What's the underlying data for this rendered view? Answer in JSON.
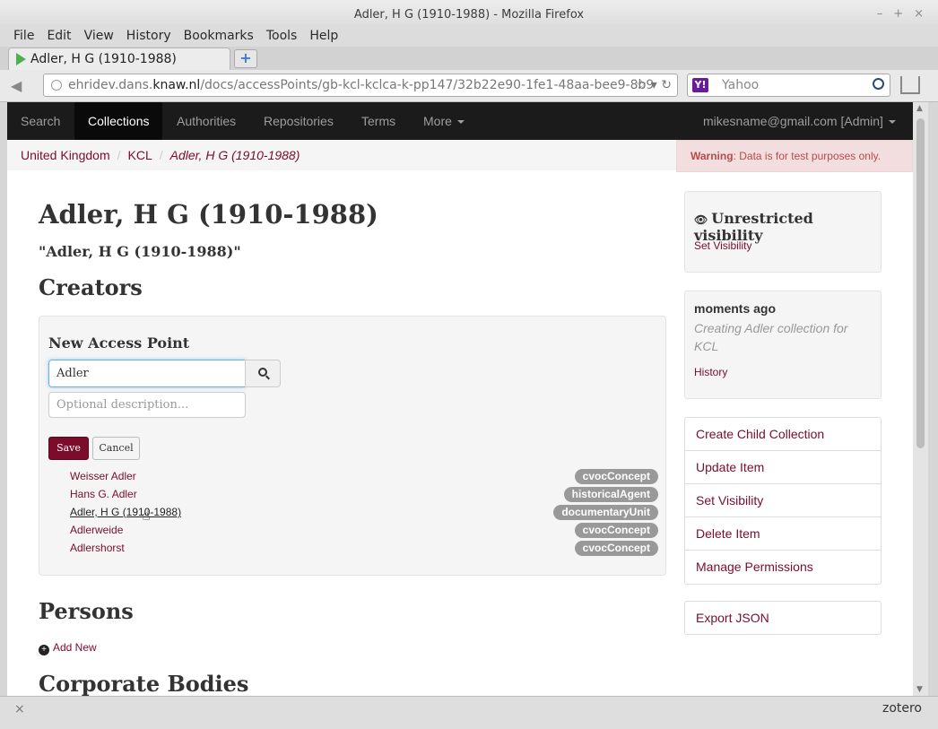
{
  "window": {
    "title": "Adler, H G (1910-1988) - Mozilla Firefox",
    "minimize_glyph": "–",
    "maximize_glyph": "+",
    "close_glyph": "×"
  },
  "menu": [
    "File",
    "Edit",
    "View",
    "History",
    "Bookmarks",
    "Tools",
    "Help"
  ],
  "tab": {
    "label": "Adler, H G (1910-1988)",
    "new_tab_glyph": "+"
  },
  "navbar": {
    "url_prefix": "ehridev.dans.",
    "url_domain": "knaw.nl",
    "url_path": "/docs/accessPoints/gb-kcl-kclca-k-pp147/32b22e90-1fe1-48aa-bee9-8b9",
    "url_tail": "☆ ▾ ↻",
    "search_placeholder": "Yahoo",
    "search_engine_glyph": "Y!"
  },
  "site": {
    "nav": [
      "Search",
      "Collections",
      "Authorities",
      "Repositories",
      "Terms"
    ],
    "more_label": "More",
    "user_label": "mikesname@gmail.com [Admin]"
  },
  "breadcrumb": [
    "United Kingdom",
    "KCL",
    "Adler, H G (1910-1988)"
  ],
  "breadcrumb_sep": "/",
  "warning": {
    "bold": "Warning",
    "text": ": Data is for test purposes only."
  },
  "main": {
    "title": "Adler, H G (1910-1988)",
    "subtitle": "\"Adler, H G (1910-1988)\"",
    "creators_heading": "Creators",
    "panel_title": "New Access Point",
    "input_value": "Adler",
    "desc_placeholder": "Optional description...",
    "save_label": "Save",
    "cancel_label": "Cancel",
    "suggestions": [
      {
        "name": "Weisser Adler",
        "type": "cvocConcept"
      },
      {
        "name": "Hans G. Adler",
        "type": "historicalAgent"
      },
      {
        "name": "Adler, H G (1910-1988)",
        "type": "documentaryUnit"
      },
      {
        "name": "Adlerweide",
        "type": "cvocConcept"
      },
      {
        "name": "Adlershorst",
        "type": "cvocConcept"
      }
    ],
    "persons_heading": "Persons",
    "add_new_label": "Add New",
    "add_new_glyph": "+",
    "corporate_heading": "Corporate Bodies"
  },
  "sidebar": {
    "visibility_title": "Unrestricted visibility",
    "visibility_icon": "eye-icon",
    "set_visibility_link": "Set Visibility",
    "history_time": "moments ago",
    "history_desc": "Creating Adler collection for KCL",
    "history_link": "History",
    "actions": [
      "Create Child Collection",
      "Update Item",
      "Set Visibility",
      "Delete Item",
      "Manage Permissions"
    ],
    "export_label": "Export JSON"
  },
  "statusbar": {
    "close_glyph": "×",
    "right_label": "zotero"
  },
  "colors": {
    "accent": "#7b0c2c",
    "nav_bg": "#1b1b1b",
    "badge": "#999999",
    "warning_text": "#b94a48"
  }
}
